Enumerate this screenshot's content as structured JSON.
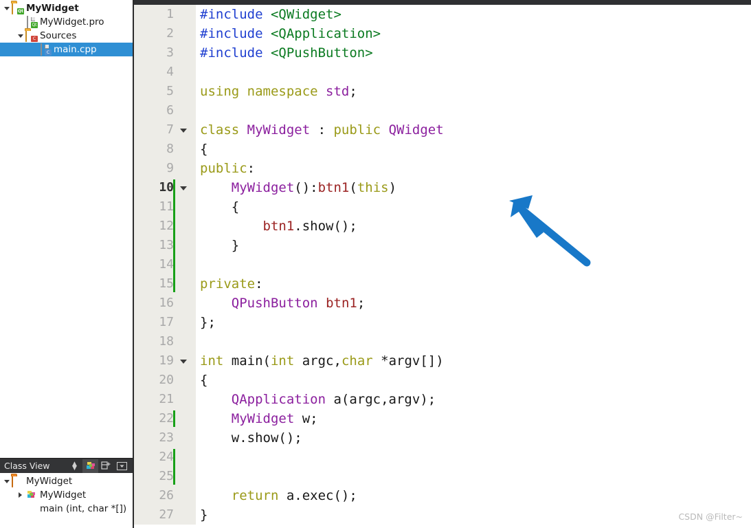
{
  "sidebar": {
    "project_tree": [
      {
        "label": "MyWidget",
        "icon": "folder-qt-icon",
        "indent": 0,
        "twisty": "open",
        "bold": true,
        "selected": false
      },
      {
        "label": "MyWidget.pro",
        "icon": "file-qt-icon",
        "indent": 1,
        "twisty": "none",
        "bold": false,
        "selected": false
      },
      {
        "label": "Sources",
        "icon": "folder-cpp-icon",
        "indent": 1,
        "twisty": "open",
        "bold": false,
        "selected": false
      },
      {
        "label": "main.cpp",
        "icon": "file-cpp-icon",
        "indent": 2,
        "twisty": "none",
        "bold": false,
        "selected": true
      }
    ],
    "classview": {
      "title": "Class View",
      "buttons": [
        {
          "name": "sync-updown-button",
          "glyph": "▲▼",
          "active": false
        },
        {
          "name": "filter-symbols-button",
          "glyph": "",
          "active": true
        },
        {
          "name": "expand-all-button",
          "glyph": "⊞",
          "active": false
        },
        {
          "name": "panel-menu-button",
          "glyph": "▾",
          "active": false
        }
      ],
      "tree": [
        {
          "label": "MyWidget",
          "icon": "folder-icon",
          "indent": 0,
          "twisty": "open",
          "bold": false
        },
        {
          "label": "MyWidget",
          "icon": "class-icon",
          "indent": 1,
          "twisty": "closed",
          "bold": false
        },
        {
          "label": "main (int, char *[])",
          "icon": "function-icon",
          "indent": 1,
          "twisty": "none",
          "bold": false
        }
      ]
    }
  },
  "editor": {
    "current_line": 10,
    "change_markers": [
      {
        "from_line": 10,
        "to_line": 15
      },
      {
        "from_line": 22,
        "to_line": 22
      },
      {
        "from_line": 24,
        "to_line": 25
      }
    ],
    "fold_lines": [
      7,
      10,
      19
    ],
    "lines": [
      {
        "n": 1,
        "tokens": [
          {
            "t": "#include ",
            "c": "pre"
          },
          {
            "t": "<QWidget>",
            "c": "str"
          }
        ]
      },
      {
        "n": 2,
        "tokens": [
          {
            "t": "#include ",
            "c": "pre"
          },
          {
            "t": "<QApplication>",
            "c": "str"
          }
        ]
      },
      {
        "n": 3,
        "tokens": [
          {
            "t": "#include ",
            "c": "pre"
          },
          {
            "t": "<QPushButton>",
            "c": "str"
          }
        ]
      },
      {
        "n": 4,
        "tokens": []
      },
      {
        "n": 5,
        "tokens": [
          {
            "t": "using namespace ",
            "c": "kw"
          },
          {
            "t": "std",
            "c": "type"
          },
          {
            "t": ";",
            "c": "pln"
          }
        ]
      },
      {
        "n": 6,
        "tokens": []
      },
      {
        "n": 7,
        "tokens": [
          {
            "t": "class ",
            "c": "kw"
          },
          {
            "t": "MyWidget",
            "c": "type"
          },
          {
            "t": " : ",
            "c": "pln"
          },
          {
            "t": "public ",
            "c": "kw"
          },
          {
            "t": "QWidget",
            "c": "type"
          }
        ]
      },
      {
        "n": 8,
        "tokens": [
          {
            "t": "{",
            "c": "pln"
          }
        ]
      },
      {
        "n": 9,
        "tokens": [
          {
            "t": "public",
            "c": "kw"
          },
          {
            "t": ":",
            "c": "pln"
          }
        ]
      },
      {
        "n": 10,
        "tokens": [
          {
            "t": "    ",
            "c": "pln"
          },
          {
            "t": "MyWidget",
            "c": "type"
          },
          {
            "t": "():",
            "c": "pln"
          },
          {
            "t": "btn1",
            "c": "fld"
          },
          {
            "t": "(",
            "c": "pln"
          },
          {
            "t": "this",
            "c": "kw"
          },
          {
            "t": ")",
            "c": "pln"
          }
        ]
      },
      {
        "n": 11,
        "tokens": [
          {
            "t": "    {",
            "c": "pln"
          }
        ]
      },
      {
        "n": 12,
        "tokens": [
          {
            "t": "        ",
            "c": "pln"
          },
          {
            "t": "btn1",
            "c": "fld"
          },
          {
            "t": ".show();",
            "c": "pln"
          }
        ]
      },
      {
        "n": 13,
        "tokens": [
          {
            "t": "    }",
            "c": "pln"
          }
        ]
      },
      {
        "n": 14,
        "tokens": []
      },
      {
        "n": 15,
        "tokens": [
          {
            "t": "private",
            "c": "kw"
          },
          {
            "t": ":",
            "c": "pln"
          }
        ]
      },
      {
        "n": 16,
        "tokens": [
          {
            "t": "    ",
            "c": "pln"
          },
          {
            "t": "QPushButton",
            "c": "type"
          },
          {
            "t": " ",
            "c": "pln"
          },
          {
            "t": "btn1",
            "c": "fld"
          },
          {
            "t": ";",
            "c": "pln"
          }
        ]
      },
      {
        "n": 17,
        "tokens": [
          {
            "t": "};",
            "c": "pln"
          }
        ]
      },
      {
        "n": 18,
        "tokens": []
      },
      {
        "n": 19,
        "tokens": [
          {
            "t": "int ",
            "c": "kw"
          },
          {
            "t": "main(",
            "c": "pln"
          },
          {
            "t": "int ",
            "c": "kw"
          },
          {
            "t": "argc,",
            "c": "pln"
          },
          {
            "t": "char ",
            "c": "kw"
          },
          {
            "t": "*argv[])",
            "c": "pln"
          }
        ]
      },
      {
        "n": 20,
        "tokens": [
          {
            "t": "{",
            "c": "pln"
          }
        ]
      },
      {
        "n": 21,
        "tokens": [
          {
            "t": "    ",
            "c": "pln"
          },
          {
            "t": "QApplication",
            "c": "type"
          },
          {
            "t": " a(argc,argv);",
            "c": "pln"
          }
        ]
      },
      {
        "n": 22,
        "tokens": [
          {
            "t": "    ",
            "c": "pln"
          },
          {
            "t": "MyWidget",
            "c": "type"
          },
          {
            "t": " w;",
            "c": "pln"
          }
        ]
      },
      {
        "n": 23,
        "tokens": [
          {
            "t": "    w.show();",
            "c": "pln"
          }
        ]
      },
      {
        "n": 24,
        "tokens": []
      },
      {
        "n": 25,
        "tokens": []
      },
      {
        "n": 26,
        "tokens": [
          {
            "t": "    ",
            "c": "pln"
          },
          {
            "t": "return ",
            "c": "kw"
          },
          {
            "t": "a.exec();",
            "c": "pln"
          }
        ]
      },
      {
        "n": 27,
        "tokens": [
          {
            "t": "}",
            "c": "pln"
          }
        ]
      }
    ]
  },
  "annotation": {
    "arrow_color": "#1878c8",
    "name": "blue-arrow-annotation"
  },
  "watermark": {
    "text": "CSDN @Filter~"
  },
  "colors": {
    "selection_blue": "#2f8fd4",
    "gutter_bg": "#edece7",
    "panel_header_bg": "#333436",
    "change_marker_green": "#18a018"
  }
}
